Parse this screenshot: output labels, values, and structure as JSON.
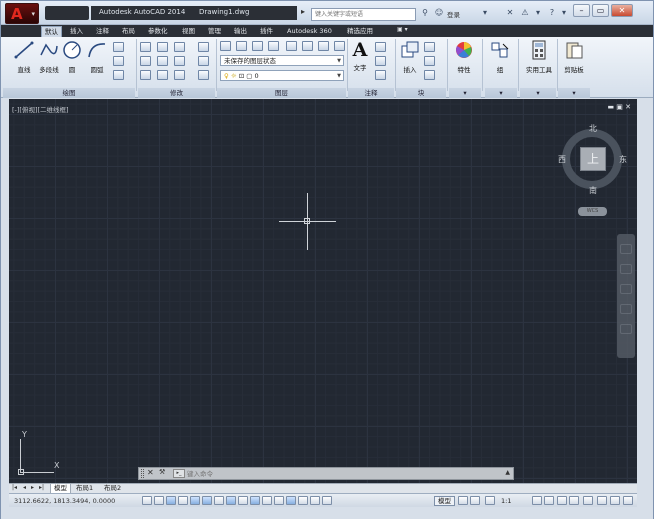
{
  "titlebar": {
    "app_title": "Autodesk AutoCAD 2014",
    "doc_title": "Drawing1.dwg",
    "app_logo": "A",
    "search_placeholder": "键入关键字或短语",
    "login_label": "登录"
  },
  "ribbon_tabs": [
    "默认",
    "插入",
    "注释",
    "布局",
    "参数化",
    "视图",
    "管理",
    "输出",
    "插件",
    "Autodesk 360",
    "精选应用"
  ],
  "active_tab": "默认",
  "ribbon": {
    "draw": {
      "title": "绘图",
      "line": "直线",
      "polyline": "多段线",
      "circle": "圆",
      "arc": "圆弧"
    },
    "modify": {
      "title": "修改"
    },
    "layers": {
      "title": "图层",
      "layer_state": "未保存的图层状态",
      "current_layer": "0"
    },
    "annotation": {
      "title": "注释",
      "text": "文字"
    },
    "block": {
      "title": "块",
      "insert": "插入"
    },
    "properties": {
      "label": "特性"
    },
    "groups": {
      "label": "组"
    },
    "utilities": {
      "label": "实用工具"
    },
    "clipboard": {
      "label": "剪贴板"
    }
  },
  "viewport": {
    "label": "[-][俯视][二维线框]",
    "controls": "▬  ▣  ✕"
  },
  "viewcube": {
    "north": "北",
    "south": "南",
    "east": "东",
    "west": "西",
    "face": "上",
    "wcs": "WCS"
  },
  "ucs": {
    "x": "X",
    "y": "Y"
  },
  "command_line": {
    "placeholder": "键入命令",
    "prompt_icon": "▸_"
  },
  "layout_tabs": [
    "模型",
    "布局1",
    "布局2"
  ],
  "active_layout": "模型",
  "statusbar": {
    "coords": "3112.6622, 1813.3494, 0.0000",
    "model": "模型",
    "scale": "1:1"
  },
  "colors": {
    "canvas": "#222832",
    "ribbon": "#dfe7f1",
    "tabbar": "#2b2f36",
    "logo": "#e0281e"
  }
}
